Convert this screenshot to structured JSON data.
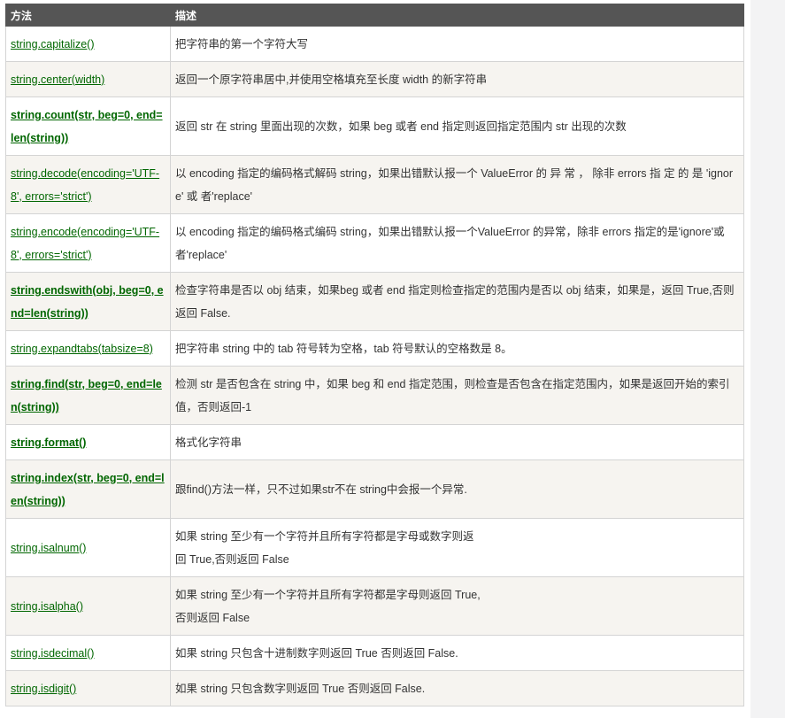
{
  "table": {
    "headers": [
      "方法",
      "描述"
    ],
    "rows": [
      {
        "method": "string.capitalize()",
        "bold": false,
        "desc_lines": [
          "把字符串的第一个字符大写"
        ]
      },
      {
        "method": "string.center(width)",
        "bold": false,
        "desc_lines": [
          "返回一个原字符串居中,并使用空格填充至长度 width 的新字符串"
        ]
      },
      {
        "method": "string.count(str, beg=0, end=len(string))",
        "bold": true,
        "desc_lines": [
          "返回 str 在 string 里面出现的次数，如果 beg 或者 end 指定则返回指定范围内 str 出现的次数"
        ]
      },
      {
        "method": "string.decode(encoding='UTF-8', errors='strict')",
        "bold": false,
        "desc_lines": [
          "以 encoding 指定的编码格式解码 string，如果出错默认报一个 ValueError 的 异 常 ， 除非 errors 指 定 的 是 'ignore' 或 者'replace'"
        ]
      },
      {
        "method": "string.encode(encoding='UTF-8', errors='strict')",
        "bold": false,
        "desc_lines": [
          "以 encoding 指定的编码格式编码 string，如果出错默认报一个ValueError 的异常，除非 errors 指定的是'ignore'或者'replace'"
        ]
      },
      {
        "method": "string.endswith(obj, beg=0, end=len(string))",
        "bold": true,
        "desc_lines": [
          "检查字符串是否以 obj 结束，如果beg 或者 end 指定则检查指定的范围内是否以 obj 结束，如果是，返回 True,否则返回 False."
        ]
      },
      {
        "method": "string.expandtabs(tabsize=8)",
        "bold": false,
        "desc_lines": [
          "把字符串 string 中的 tab 符号转为空格，tab 符号默认的空格数是 8。"
        ]
      },
      {
        "method": "string.find(str, beg=0, end=len(string))",
        "bold": true,
        "desc_lines": [
          "检测 str 是否包含在 string 中，如果 beg 和 end 指定范围，则检查是否包含在指定范围内，如果是返回开始的索引值，否则返回-1"
        ]
      },
      {
        "method": "string.format()",
        "bold": true,
        "desc_lines": [
          "格式化字符串"
        ]
      },
      {
        "method": "string.index(str, beg=0, end=len(string))",
        "bold": true,
        "desc_lines": [
          "跟find()方法一样，只不过如果str不在 string中会报一个异常."
        ]
      },
      {
        "method": "string.isalnum()",
        "bold": false,
        "desc_lines": [
          "如果 string 至少有一个字符并且所有字符都是字母或数字则返",
          "回 True,否则返回 False"
        ]
      },
      {
        "method": "string.isalpha()",
        "bold": false,
        "desc_lines": [
          "如果 string 至少有一个字符并且所有字符都是字母则返回 True,",
          "否则返回 False"
        ]
      },
      {
        "method": "string.isdecimal()",
        "bold": false,
        "desc_lines": [
          "如果 string 只包含十进制数字则返回 True 否则返回 False."
        ]
      },
      {
        "method": "string.isdigit()",
        "bold": false,
        "desc_lines": [
          "如果 string 只包含数字则返回 True 否则返回 False."
        ]
      }
    ]
  }
}
